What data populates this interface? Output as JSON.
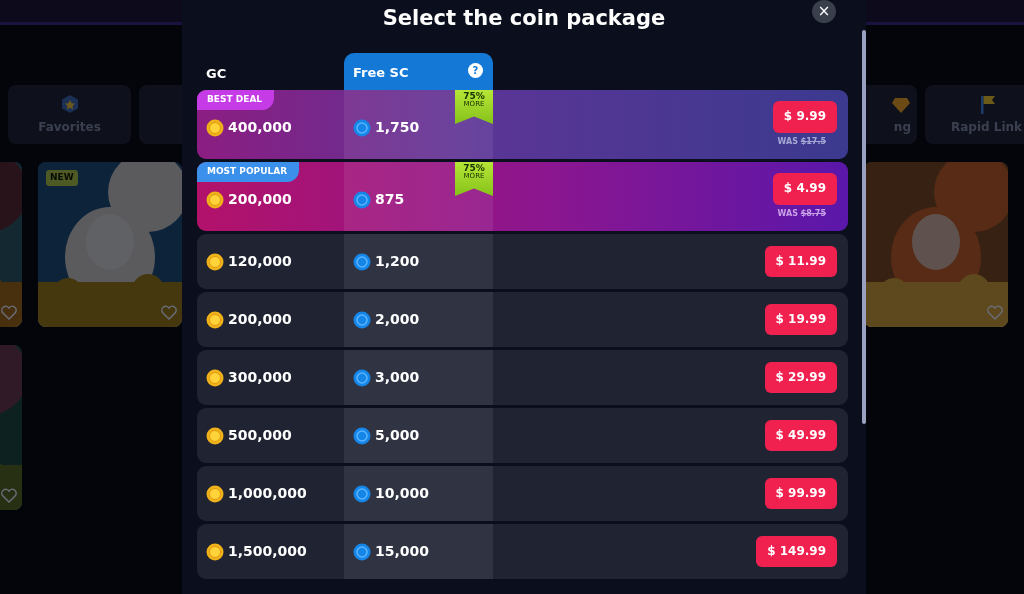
{
  "background": {
    "tiles": [
      {
        "label": "Favorites"
      },
      {
        "label": "ng"
      },
      {
        "label": "Rapid Link"
      }
    ],
    "games": [
      {
        "favorite": false
      },
      {
        "favorite": false,
        "badge": "NEW"
      },
      {
        "favorite": false
      },
      {
        "favorite": false
      }
    ]
  },
  "modal": {
    "title": "Select the coin package",
    "close": "×",
    "columns": [
      {
        "label": "GC"
      },
      {
        "label": "Free SC",
        "help": "?"
      }
    ],
    "rows": [
      {
        "kind": "best_deal",
        "badge": "BEST DEAL",
        "gc": "400,000",
        "sc": "1,750",
        "bonus": "75%",
        "bonus_note": "MORE",
        "price": "$ 9.99",
        "was_label": "WAS",
        "was_price": "$17.5"
      },
      {
        "kind": "most_popular",
        "badge": "MOST POPULAR",
        "gc": "200,000",
        "sc": "875",
        "bonus": "75%",
        "bonus_note": "MORE",
        "price": "$ 4.99",
        "was_label": "WAS",
        "was_price": "$8.75"
      },
      {
        "kind": "standard",
        "gc": "120,000",
        "sc": "1,200",
        "price": "$ 11.99"
      },
      {
        "kind": "standard",
        "gc": "200,000",
        "sc": "2,000",
        "price": "$ 19.99"
      },
      {
        "kind": "standard",
        "gc": "300,000",
        "sc": "3,000",
        "price": "$ 29.99"
      },
      {
        "kind": "standard",
        "gc": "500,000",
        "sc": "5,000",
        "price": "$ 49.99"
      },
      {
        "kind": "standard",
        "gc": "1,000,000",
        "sc": "10,000",
        "price": "$ 99.99"
      },
      {
        "kind": "standard",
        "gc": "1,500,000",
        "sc": "15,000",
        "price": "$ 149.99"
      }
    ]
  }
}
